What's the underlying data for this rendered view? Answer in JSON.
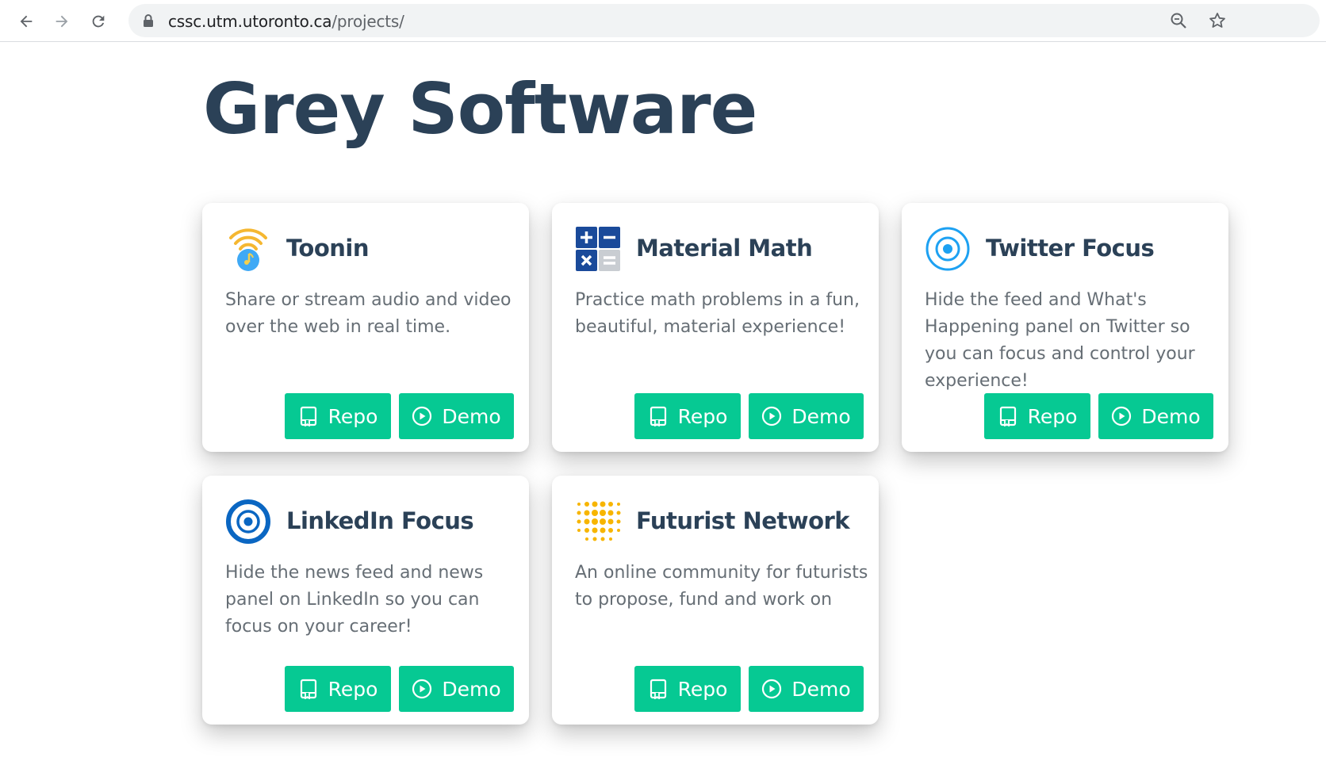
{
  "browser": {
    "url_host": "cssc.utm.utoronto.ca",
    "url_path": "/projects/",
    "icons": [
      "back-icon",
      "forward-icon",
      "reload-icon",
      "lock-icon",
      "zoom-icon",
      "bookmark-star-icon"
    ]
  },
  "page": {
    "title": "Grey Software"
  },
  "colors": {
    "title": "#2b4157",
    "button": "#06c993",
    "description": "#666e75"
  },
  "projects": [
    {
      "name": "Toonin",
      "description": "Share or stream audio and video over the web in real time.",
      "icon": "wifi-music-icon",
      "repo_label": "Repo",
      "demo_label": "Demo"
    },
    {
      "name": "Material Math",
      "description": "Practice math problems in a fun, beautiful, material experience!",
      "icon": "calculator-icon",
      "repo_label": "Repo",
      "demo_label": "Demo"
    },
    {
      "name": "Twitter Focus",
      "description": "Hide the feed and What's Happening panel on Twitter so you can focus and control your experience!",
      "icon": "target-icon",
      "repo_label": "Repo",
      "demo_label": "Demo"
    },
    {
      "name": "LinkedIn Focus",
      "description": "Hide the news feed and news panel on LinkedIn so you can focus on your career!",
      "icon": "target-icon",
      "repo_label": "Repo",
      "demo_label": "Demo"
    },
    {
      "name": "Futurist Network",
      "description": "An online community for futurists to propose, fund and work on",
      "icon": "dot-grid-icon",
      "repo_label": "Repo",
      "demo_label": "Demo"
    }
  ]
}
